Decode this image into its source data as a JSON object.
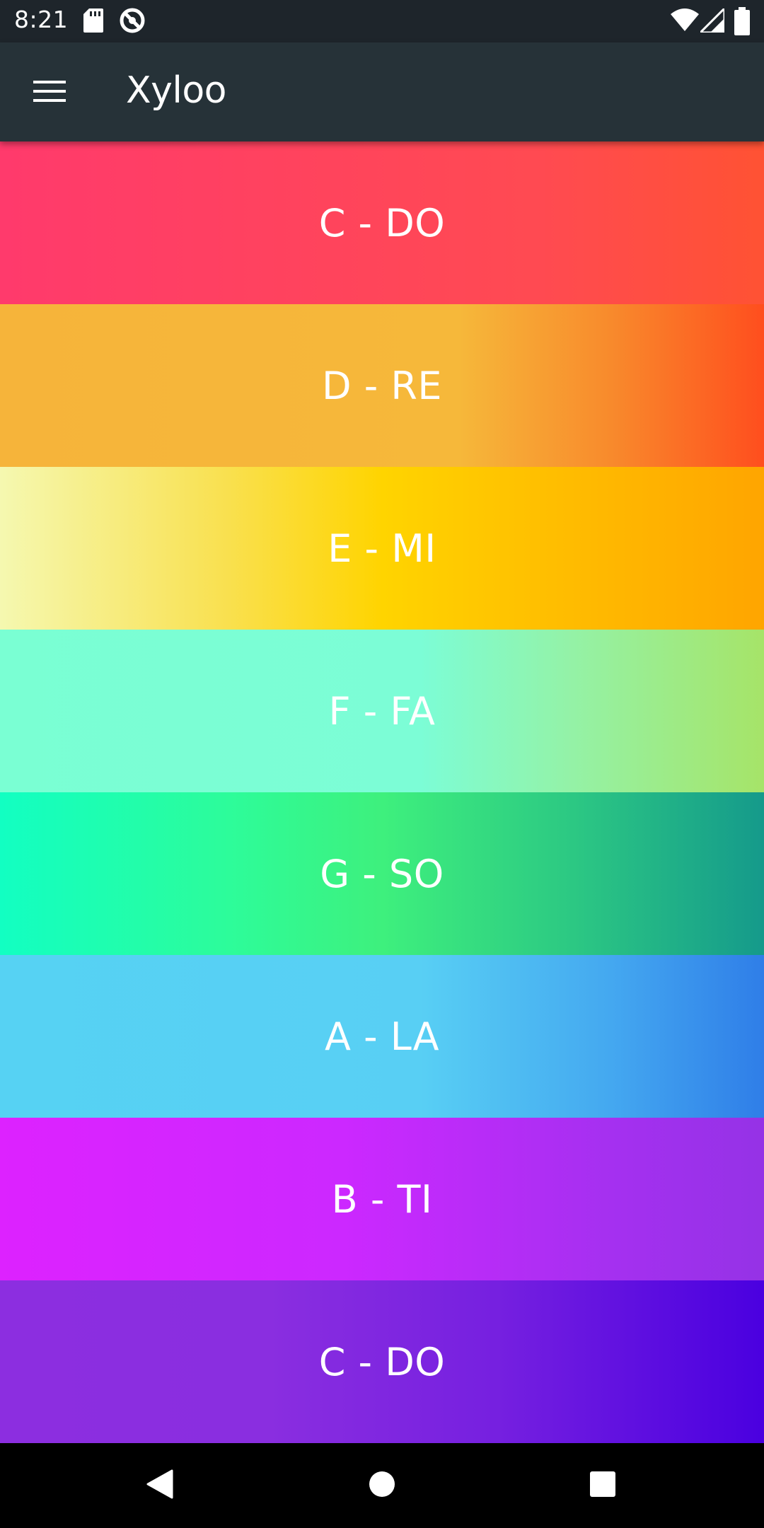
{
  "status_bar": {
    "time": "8:21",
    "icons": [
      "sd-card-icon",
      "sync-icon",
      "wifi-icon",
      "signal-icon",
      "battery-icon"
    ]
  },
  "app_bar": {
    "title": "Xyloo",
    "menu_icon": "menu-icon"
  },
  "keys": [
    {
      "label": "C - DO"
    },
    {
      "label": "D - RE"
    },
    {
      "label": "E - MI"
    },
    {
      "label": "F - FA"
    },
    {
      "label": "G - SO"
    },
    {
      "label": "A - LA"
    },
    {
      "label": "B - TI"
    },
    {
      "label": "C - DO"
    }
  ],
  "nav_bar": {
    "icons": [
      "back-icon",
      "home-icon",
      "recents-icon"
    ]
  },
  "colors": {
    "status_bar": "#1e252b",
    "app_bar": "#263238",
    "nav_bar": "#000000"
  }
}
